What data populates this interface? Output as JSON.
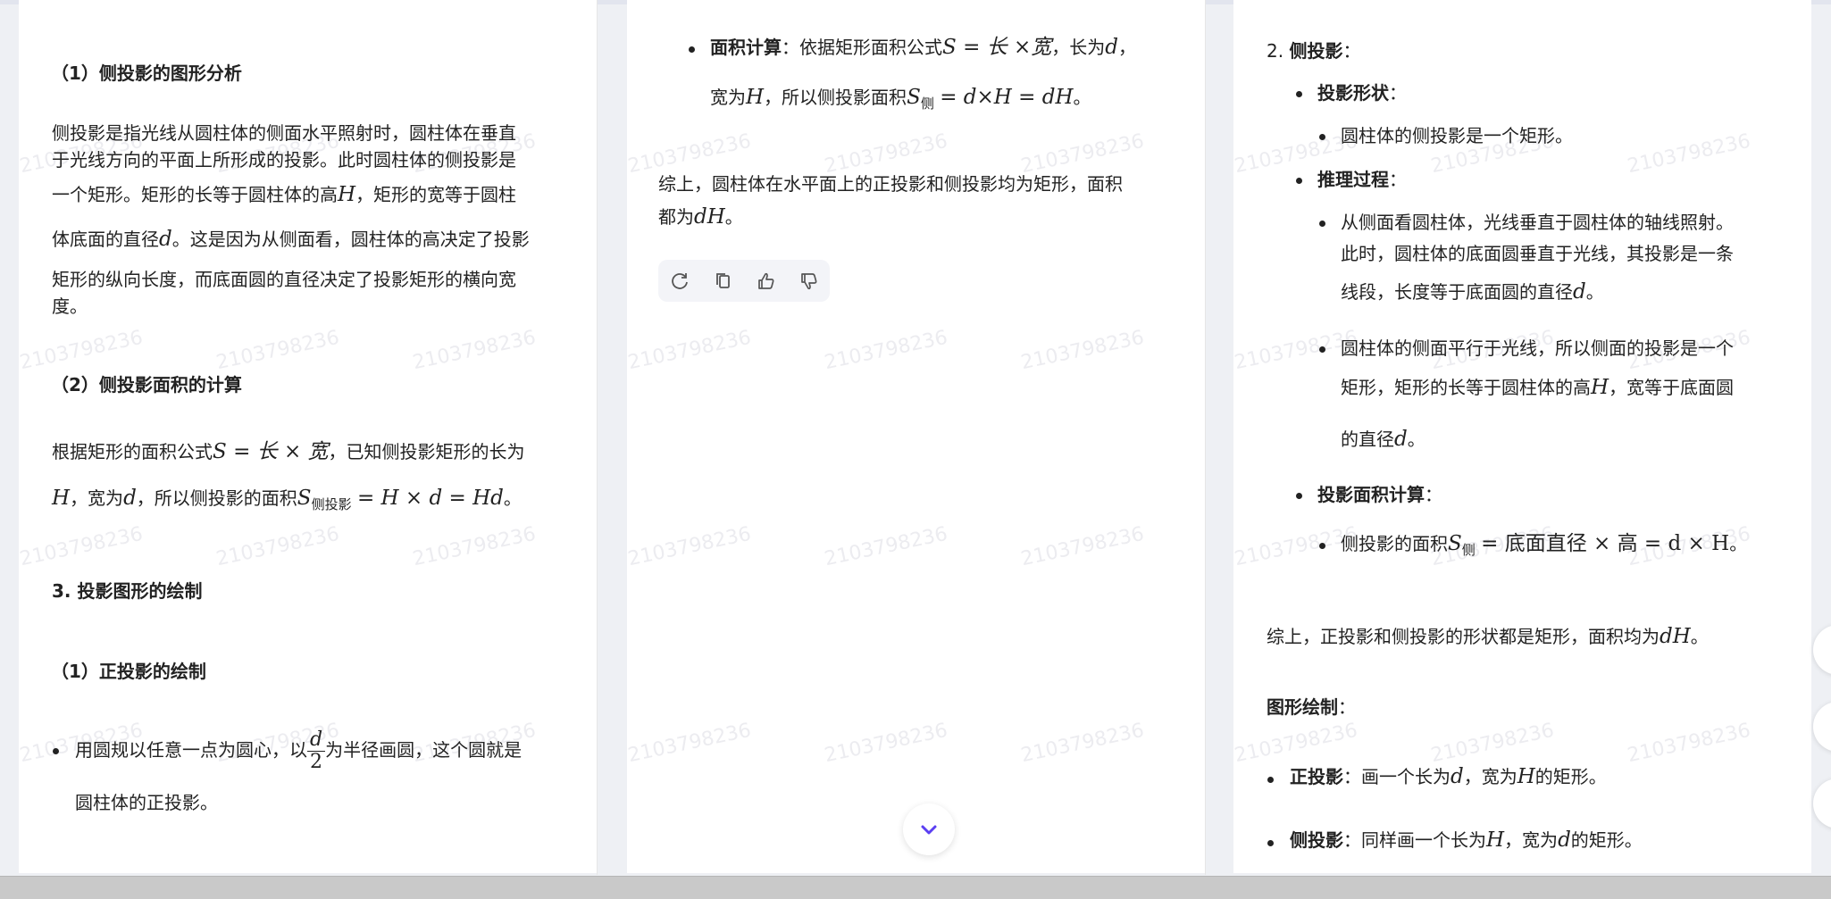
{
  "watermark": "2103798236",
  "panel1": {
    "h_side_analysis": "（1）侧投影的图形分析",
    "para1_l1": "侧投影是指光线从圆柱体的侧面水平照射时，圆柱体在垂直",
    "para1_l2": "于光线方向的平面上所形成的投影。此时圆柱体的侧投影是",
    "para1_l3a": "一个矩形。矩形的长等于圆柱体的高",
    "para1_l3b": "，矩形的宽等于圆柱",
    "para1_l4a": "体底面的直径",
    "para1_l4b": "。这是因为从侧面看，圆柱体的高决定了投影",
    "para1_l5": "矩形的纵向长度，而底面圆的直径决定了投影矩形的横向宽",
    "para1_l6": "度。",
    "h_side_area": "（2）侧投影面积的计算",
    "para2_l1a": "根据矩形的面积公式",
    "para2_l1_formula": "S = 长 × 宽",
    "para2_l1b": "，已知侧投影矩形的长为",
    "para2_l2a": "，宽为",
    "para2_l2b": "，所以侧投影的面积",
    "para2_l2_sub": "侧投影",
    "para2_l2_formula": "= H × d = Hd",
    "para2_l2c": "。",
    "h_drawing": "3. 投影图形的绘制",
    "h_front_draw": "（1）正投影的绘制",
    "bullet1a": "用圆规以任意一点为圆心，以",
    "bullet1b": "为半径画圆，这个圆就是",
    "bullet1_l2": "圆柱体的正投影。",
    "frac_num": "d",
    "frac_den": "2"
  },
  "panel2": {
    "bullet_label": "面积计算",
    "bullet_a": "：依据矩形面积公式",
    "formula1": "S = 长 ×宽",
    "bullet_b": "，长为",
    "bullet_c": "，",
    "line2a": "宽为",
    "line2b": "，所以侧投影面积",
    "sub_side": "侧",
    "formula2": "= d×H = dH",
    "line2c": "。",
    "summary_l1": "综上，圆柱体在水平面上的正投影和侧投影均为矩形，面积",
    "summary_l2a": "都为",
    "summary_l2b": "。",
    "var_dH": "dH"
  },
  "panel3": {
    "item_num": "2.",
    "item_label": "侧投影",
    "colon": "：",
    "shape_label": "投影形状",
    "shape_text": "圆柱体的侧投影是一个矩形。",
    "reason_label": "推理过程",
    "reason1_l1": "从侧面看圆柱体，光线垂直于圆柱体的轴线照射。",
    "reason1_l2": "此时，圆柱体的底面圆垂直于光线，其投影是一条",
    "reason1_l3a": "线段，长度等于底面圆的直径",
    "reason1_l3b": "。",
    "reason2_l1": "圆柱体的侧面平行于光线，所以侧面的投影是一个",
    "reason2_l2a": "矩形，矩形的长等于圆柱体的高",
    "reason2_l2b": "，宽等于底面圆",
    "reason2_l3a": "的直径",
    "reason2_l3b": "。",
    "area_label": "投影面积计算",
    "area_text_a": "侧投影的面积",
    "area_sub": "侧",
    "area_formula": "= 底面直径 × 高 = d × H",
    "area_text_b": "。",
    "summary_a": "综上，正投影和侧投影的形状都是矩形，面积均为",
    "summary_b": "。",
    "drawing_label": "图形绘制",
    "front_label": "正投影",
    "front_a": "：画一个长为",
    "front_b": "，宽为",
    "front_c": "的矩形。",
    "side_label": "侧投影",
    "side_a": "：同样画一个长为",
    "side_b": "，宽为",
    "side_c": "的矩形。"
  },
  "vars": {
    "H": "H",
    "d": "d",
    "S": "S",
    "dH": "dH"
  },
  "icons": [
    "refresh-icon",
    "copy-icon",
    "thumbs-up-icon",
    "thumbs-down-icon",
    "chevron-down-icon"
  ],
  "colors": {
    "accent": "#5b3ff2",
    "text": "#222222",
    "watermark": "#ececf0"
  }
}
